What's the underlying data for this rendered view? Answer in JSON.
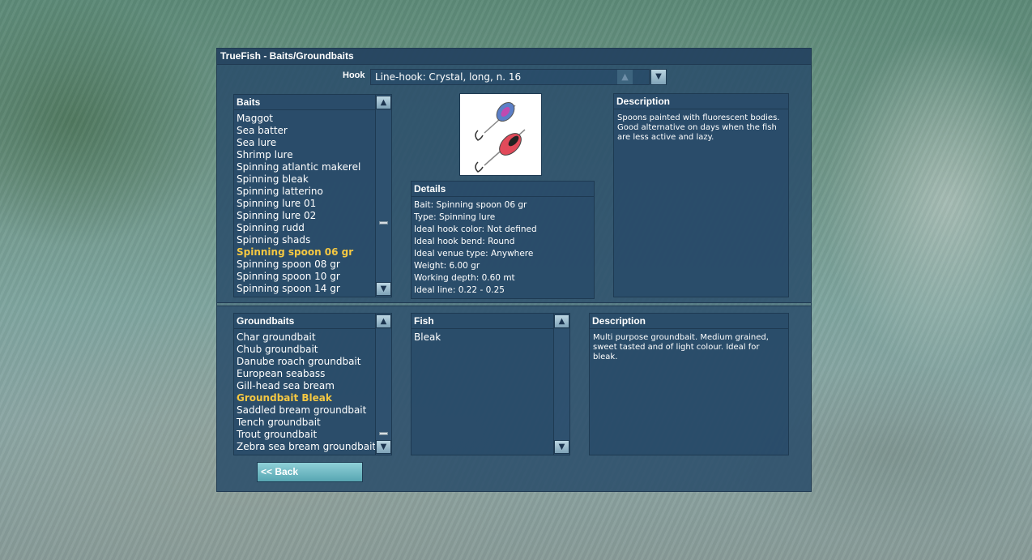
{
  "window": {
    "title": "TrueFish - Baits/Groundbaits"
  },
  "hook": {
    "label": "Hook",
    "value": "Line-hook: Crystal, long, n. 16",
    "up_icon": "triangle-up-icon",
    "down_icon": "chevron-down-icon"
  },
  "baits": {
    "header": "Baits",
    "items": [
      "Maggot",
      "Sea batter",
      "Sea lure",
      "Shrimp lure",
      "Spinning atlantic makerel",
      "Spinning bleak",
      "Spinning latterino",
      "Spinning lure 01",
      "Spinning lure 02",
      "Spinning rudd",
      "Spinning shads",
      "Spinning spoon 06 gr",
      "Spinning spoon 08 gr",
      "Spinning spoon 10 gr",
      "Spinning spoon 14 gr"
    ],
    "selected": "Spinning spoon 06 gr"
  },
  "bait_image": {
    "description": "spinning-spoon-lures-image"
  },
  "bait_description": {
    "header": "Description",
    "text": "Spoons painted with fluorescent bodies. Good alternative on days when the fish are less active and lazy."
  },
  "details": {
    "header": "Details",
    "lines": [
      "Bait: Spinning spoon 06 gr",
      "Type: Spinning lure",
      "Ideal hook color: Not defined",
      "Ideal hook bend: Round",
      "Ideal venue type: Anywhere",
      "Weight: 6.00 gr",
      "Working depth: 0.60 mt",
      "Ideal line: 0.22 - 0.25"
    ]
  },
  "groundbaits": {
    "header": "Groundbaits",
    "items": [
      "Char groundbait",
      "Chub groundbait",
      "Danube roach groundbait",
      "European seabass",
      "Gill-head sea bream",
      "Groundbait Bleak",
      "Saddled bream groundbait",
      "Tench groundbait",
      "Trout groundbait",
      "Zebra sea bream groundbait"
    ],
    "selected": "Groundbait Bleak"
  },
  "fish": {
    "header": "Fish",
    "items": [
      "Bleak"
    ]
  },
  "groundbait_description": {
    "header": "Description",
    "text": "Multi purpose groundbait. Medium grained, sweet tasted and of light colour. Ideal for bleak."
  },
  "back_button": {
    "label": "<< Back"
  },
  "colors": {
    "selected_text": "#f5c842",
    "panel_bg": "#2d5574",
    "button": "#6fb8c2"
  }
}
